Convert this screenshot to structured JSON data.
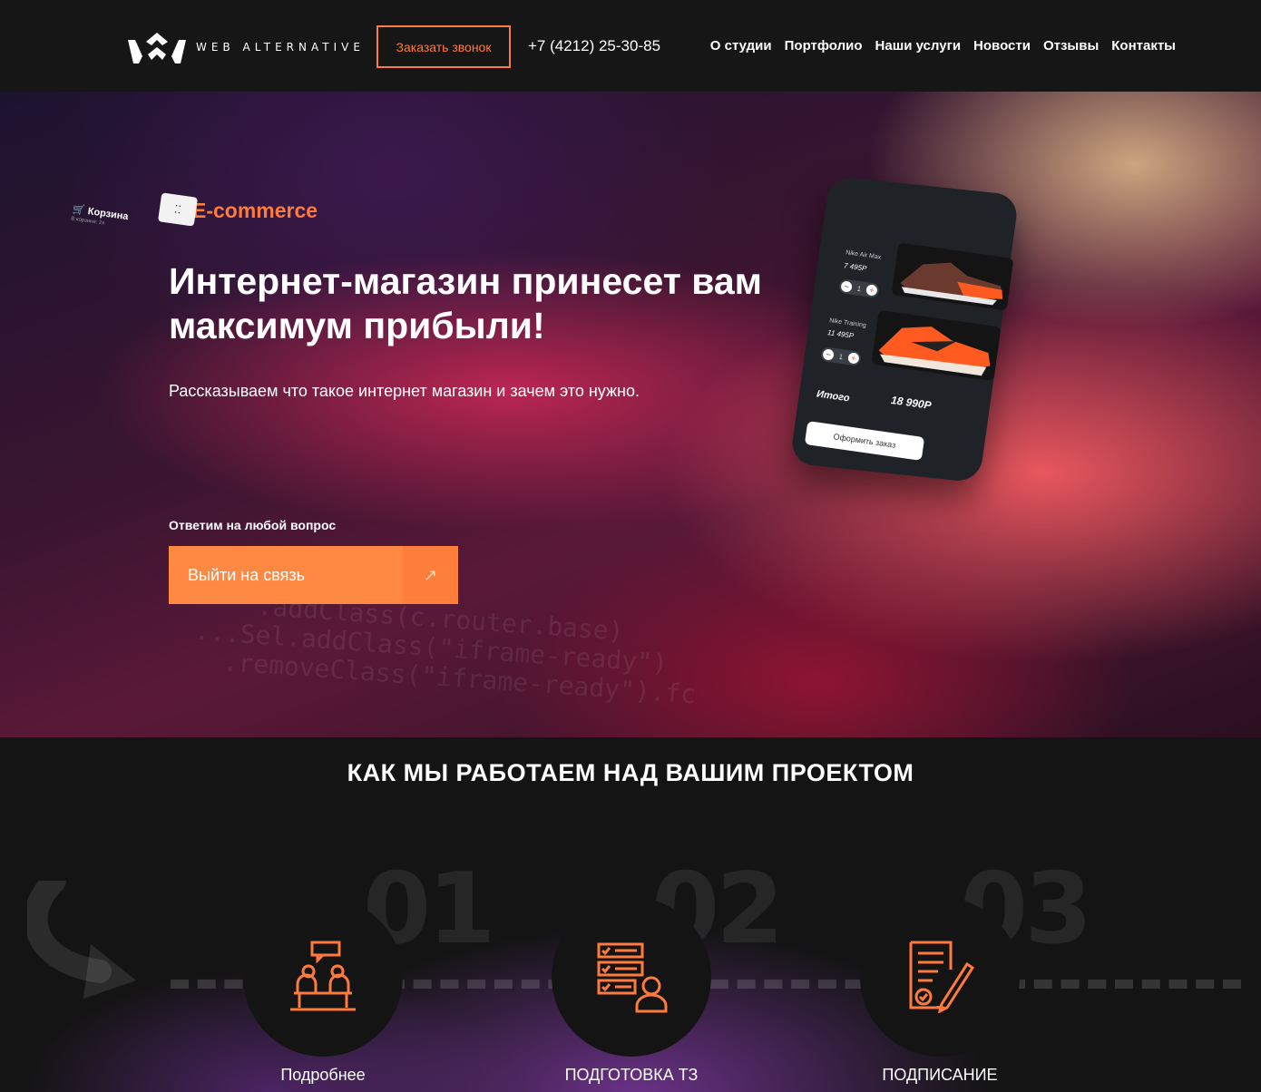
{
  "header": {
    "brand": "WEB ALTERNATIVE",
    "call_button": "Заказать звонок",
    "phone": "+7 (4212) 25-30-85",
    "nav": [
      "О студии",
      "Портфолио",
      "Наши услуги",
      "Новости",
      "Отзывы",
      "Контакты"
    ]
  },
  "hero": {
    "badge": "E-commerce",
    "badge_icon": "cart-icon",
    "title": "Интернет-магазин принесет вам максимум прибыли!",
    "subtitle": "Рассказываем что такое интернет магазин и зачем это нужно.",
    "answer_label": "Ответим на любой вопрос",
    "cta_label": "Выйти на связь",
    "cta_icon": "arrow-up-right-icon",
    "phone_mockup": {
      "cart_title": "Корзина",
      "cart_subtitle": "В корзине: 2х",
      "items": [
        {
          "name": "Nike Air Max",
          "price": "7 495Р",
          "qty": "1"
        },
        {
          "name": "Nike Training",
          "price": "11 495Р",
          "qty": "1"
        }
      ],
      "total_label": "Итого",
      "total": "18 990Р",
      "order_button": "Оформить заказ"
    }
  },
  "process": {
    "title": "КАК МЫ РАБОТАЕМ НАД ВАШИМ ПРОЕКТОМ",
    "steps": [
      {
        "number": "01",
        "label": "Подробнее",
        "icon": "meeting-icon"
      },
      {
        "number": "02",
        "label": "ПОДГОТОВКА ТЗ",
        "icon": "checklist-icon"
      },
      {
        "number": "03",
        "label": "ПОДПИСАНИЕ",
        "icon": "contract-sign-icon"
      }
    ]
  },
  "colors": {
    "accent": "#ff7a3d",
    "cta": "#ff8843",
    "header_bg": "#161616",
    "page_bg": "#141414"
  }
}
